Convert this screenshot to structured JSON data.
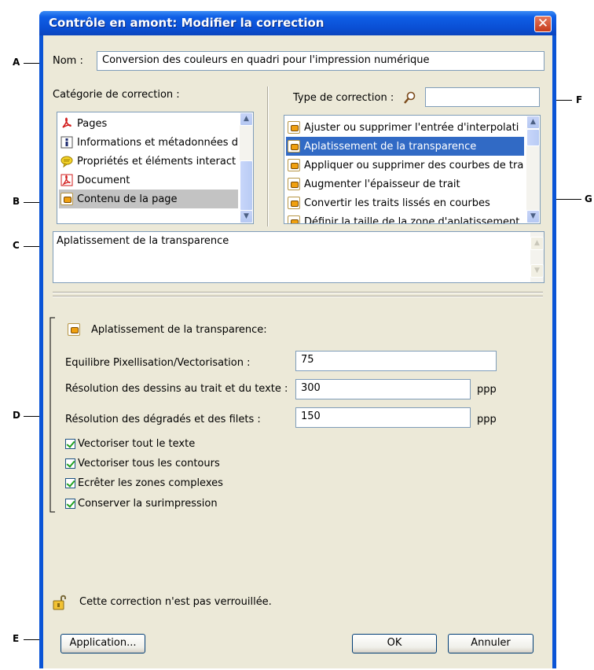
{
  "dialog": {
    "title": "Contrôle en amont: Modifier la correction",
    "close_glyph": "✕"
  },
  "name_field": {
    "label": "Nom :",
    "value": "Conversion des couleurs en quadri pour l'impression numérique"
  },
  "category": {
    "label": "Catégorie de correction :",
    "items": [
      {
        "label": "Pages",
        "icon": "pdf-icon"
      },
      {
        "label": "Informations et métadonnées d",
        "icon": "info-icon"
      },
      {
        "label": "Propriétés et éléments interact",
        "icon": "comment-icon"
      },
      {
        "label": "Document",
        "icon": "pdf-icon"
      },
      {
        "label": "Contenu de la page",
        "icon": "fixup-icon",
        "selected": true
      }
    ]
  },
  "fixup_type": {
    "label": "Type de correction :",
    "search_value": "",
    "items": [
      {
        "label": "Ajuster ou supprimer l'entrée d'interpolati"
      },
      {
        "label": "Aplatissement de la transparence",
        "selected": true
      },
      {
        "label": "Appliquer ou supprimer des courbes de tra"
      },
      {
        "label": "Augmenter l'épaisseur de trait"
      },
      {
        "label": "Convertir les traits lissés en courbes"
      },
      {
        "label": "Définir la taille de la zone d'aplatissement"
      }
    ]
  },
  "description": {
    "text": "Aplatissement de la transparence"
  },
  "settings": {
    "heading": "Aplatissement de la transparence:",
    "rows": [
      {
        "label": "Equilibre Pixellisation/Vectorisation :",
        "value": "75",
        "unit": ""
      },
      {
        "label": "Résolution des dessins au trait et du texte :",
        "value": "300",
        "unit": "ppp"
      },
      {
        "label": "Résolution des dégradés et des filets :",
        "value": "150",
        "unit": "ppp"
      }
    ],
    "checkboxes": [
      {
        "label": "Vectoriser tout le texte",
        "checked": true
      },
      {
        "label": "Vectoriser tous les contours",
        "checked": true
      },
      {
        "label": "Ecrêter les zones complexes",
        "checked": true
      },
      {
        "label": "Conserver la surimpression",
        "checked": true
      }
    ]
  },
  "lock": {
    "text": "Cette correction n'est pas verrouillée.",
    "icon": "unlocked-icon"
  },
  "buttons": {
    "application": "Application...",
    "ok": "OK",
    "cancel": "Annuler"
  },
  "callouts": [
    "A",
    "B",
    "C",
    "D",
    "E",
    "F",
    "G"
  ],
  "colors": {
    "title_bar": "#0a54d6",
    "dialog_bg": "#ece9d8",
    "selection_blue": "#316ac5",
    "selection_gray": "#c3c3c3",
    "close_button": "#c53b1c"
  }
}
